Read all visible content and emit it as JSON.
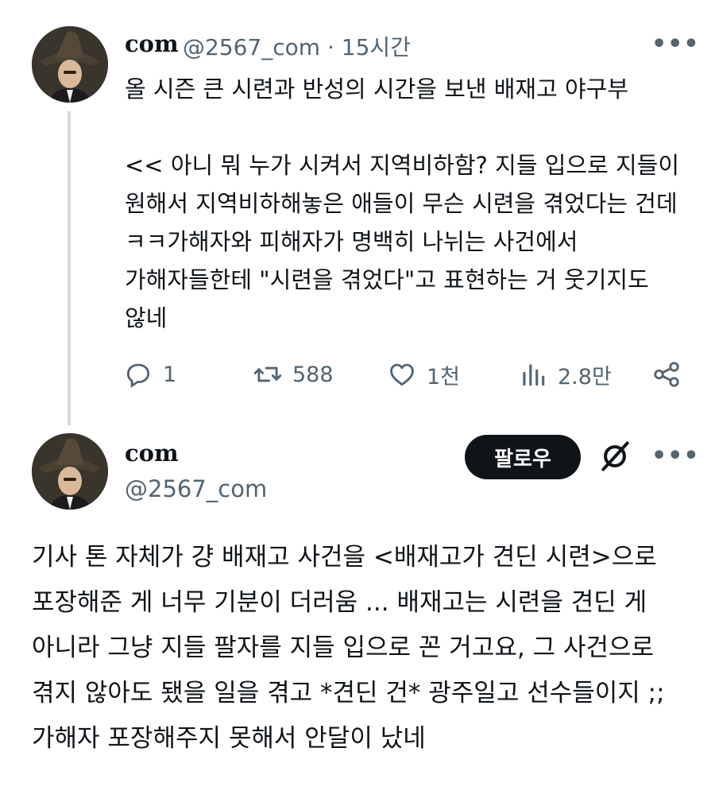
{
  "tweet": {
    "author_name": "com",
    "handle": "@2567_com",
    "separator": "·",
    "time": "15시간",
    "text": "올 시즌 큰 시련과 반성의 시간을 보낸 배재고 야구부\n\n<< 아니 뭐 누가 시켜서 지역비하함? 지들 입으로 지들이 원해서 지역비하해놓은 애들이 무슨 시련을 겪었다는 건데 ㅋㅋ가해자와 피해자가 명백히 나뉘는 사건에서 가해자들한테 \"시련을 겪었다\"고 표현하는 거 웃기지도 않네",
    "actions": {
      "reply_count": "1",
      "retweet_count": "588",
      "like_count": "1천",
      "view_count": "2.8만"
    }
  },
  "quoted": {
    "author_name": "com",
    "handle": "@2567_com",
    "follow_label": "팔로우",
    "text": "기사 톤 자체가 걍 배재고 사건을 <배재고가 견딘 시련>으로 포장해준 게 너무 기분이 더러움 ... 배재고는 시련을 견딘 게 아니라 그냥 지들 팔자를 지들 입으로 꼰 거고요, 그 사건으로 겪지 않아도 됐을 일을 겪고 *견딘 건* 광주일고 선수들이지 ;; 가해자 포장해주지 못해서 안달이 났네"
  },
  "icons": {
    "reply": "speech-bubble-icon",
    "retweet": "retweet-arrows-icon",
    "like": "heart-icon",
    "views": "bar-chart-icon",
    "share": "share-nodes-icon",
    "more": "more-dots-icon",
    "grok": "grok-slash-circle-icon"
  },
  "colors": {
    "text": "#0f1419",
    "muted": "#536471",
    "thread_line": "#cfd9de",
    "follow_bg": "#0f1419"
  }
}
